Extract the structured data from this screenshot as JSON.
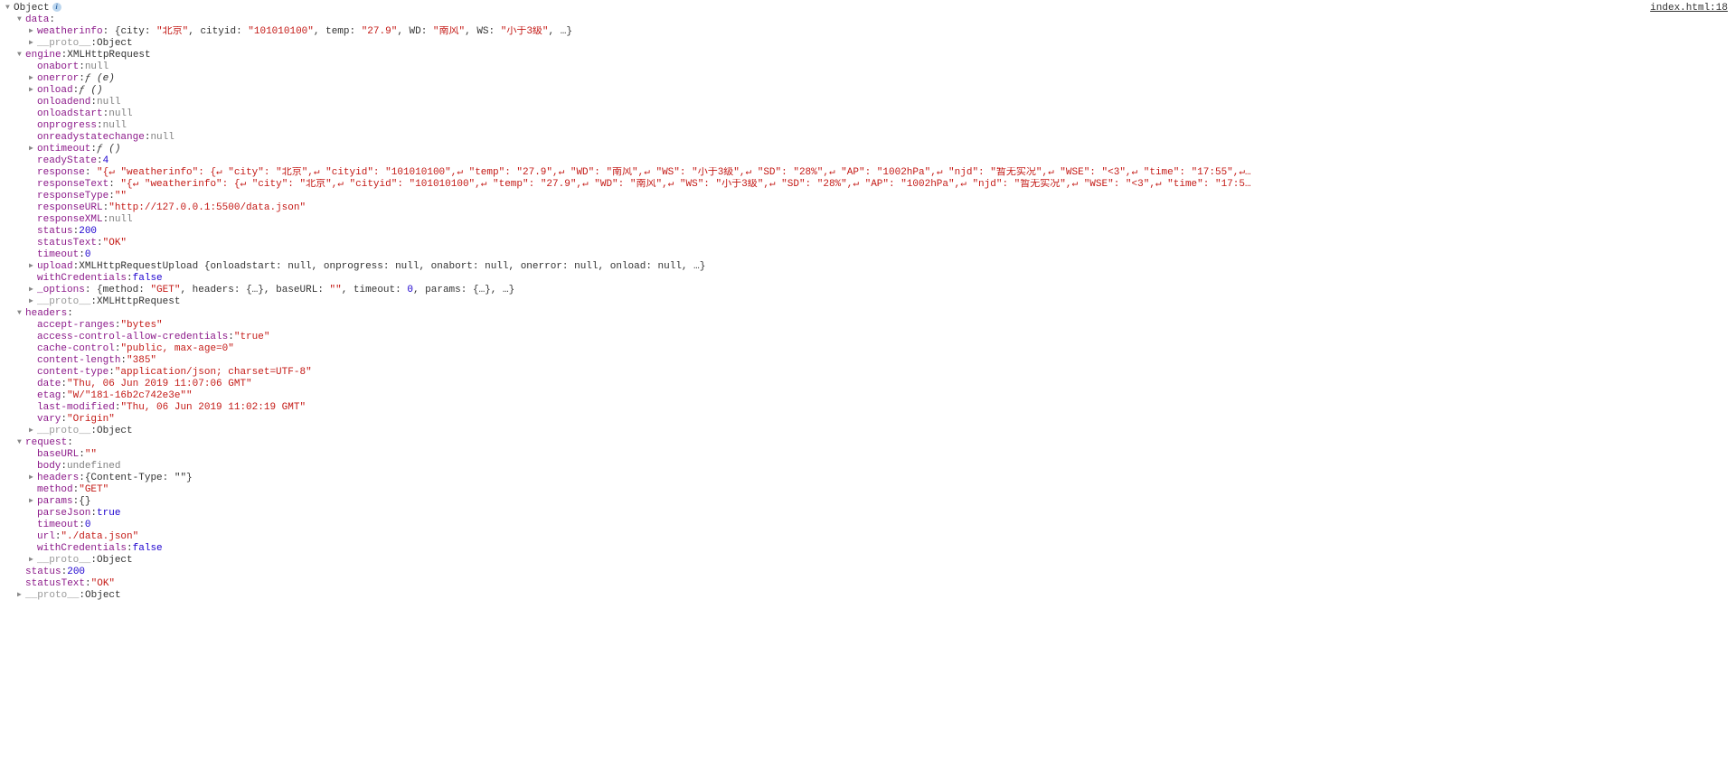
{
  "source_link": "index.html:18",
  "root_label": "Object",
  "data_key": "data",
  "weatherinfo_key": "weatherinfo",
  "weatherinfo_preview_parts": {
    "open": "{",
    "city_k": "city",
    "city_v": "\"北京\"",
    "cityid_k": "cityid",
    "cityid_v": "\"101010100\"",
    "temp_k": "temp",
    "temp_v": "\"27.9\"",
    "wd_k": "WD",
    "wd_v": "\"南风\"",
    "ws_k": "WS",
    "ws_v": "\"小于3级\"",
    "ellipsis": ", …}",
    "close": ""
  },
  "proto_key": "__proto__",
  "proto_obj": "Object",
  "proto_xhr": "XMLHttpRequest",
  "engine_key": "engine",
  "engine_type": "XMLHttpRequest",
  "engine_props": {
    "onabort": "null",
    "onerror": "ƒ (e)",
    "onload": "ƒ ()",
    "onloadend": "null",
    "onloadstart": "null",
    "onprogress": "null",
    "onreadystatechange": "null",
    "ontimeout": "ƒ ()",
    "readyState": "4",
    "responseType": "\"\"",
    "responseURL": "\"http://127.0.0.1:5500/data.json\"",
    "responseXML": "null",
    "status": "200",
    "statusText": "\"OK\"",
    "timeout": "0",
    "withCredentials": "false"
  },
  "response_key": "response",
  "responseText_key": "responseText",
  "resp_line": {
    "open": "\"{↵    \"weatherinfo\": {↵        \"city\": ",
    "v_city": "\"北京\"",
    "c1": ",↵        \"cityid\": ",
    "v_cityid": "\"101010100\"",
    "c2": ",↵        \"temp\": ",
    "v_temp": "\"27.9\"",
    "c3": ",↵        \"WD\": ",
    "v_wd": "\"南风\"",
    "c4": ",↵        \"WS\": ",
    "v_ws": "\"小于3级\"",
    "c5": ",↵        \"SD\": ",
    "v_sd": "\"28%\"",
    "c6": ",↵        \"AP\": ",
    "v_ap": "\"1002hPa\"",
    "c7": ",↵        \"njd\": ",
    "v_njd": "\"暂无实况\"",
    "c8": ",↵        \"WSE\": ",
    "v_wse": "\"<3\"",
    "c9": ",↵        \"time\": ",
    "v_time": "\"17:55\"",
    "c10": ",↵…"
  },
  "resp_text_line": {
    "open": "\"{↵    \"weatherinfo\": {↵        \"city\": ",
    "v_city": "\"北京\"",
    "c1": ",↵        \"cityid\": ",
    "v_cityid": "\"101010100\"",
    "c2": ",↵        \"temp\": ",
    "v_temp": "\"27.9\"",
    "c3": ",↵        \"WD\": ",
    "v_wd": "\"南风\"",
    "c4": ",↵        \"WS\": ",
    "v_ws": "\"小于3级\"",
    "c5": ",↵        \"SD\": ",
    "v_sd": "\"28%\"",
    "c6": ",↵        \"AP\": ",
    "v_ap": "\"1002hPa\"",
    "c7": ",↵        \"njd\": ",
    "v_njd": "\"暂无实况\"",
    "c8": ",↵        \"WSE\": ",
    "v_wse": "\"<3\"",
    "c9": ",↵        \"time\": ",
    "v_time": "\"17:5…"
  },
  "upload_key": "upload",
  "upload_preview": "XMLHttpRequestUpload {onloadstart: null, onprogress: null, onabort: null, onerror: null, onload: null, …}",
  "options_key": "_options",
  "options_preview_parts": {
    "open": "{",
    "method_k": "method",
    "method_v": "\"GET\"",
    "headers_k": "headers",
    "headers_v": "{…}",
    "baseurl_k": "baseURL",
    "baseurl_v": "\"\"",
    "timeout_k": "timeout",
    "timeout_v": "0",
    "params_k": "params",
    "params_v": "{…}",
    "close": ", …}"
  },
  "headers_key": "headers",
  "headers": {
    "accept-ranges": "\"bytes\"",
    "access-control-allow-credentials": "\"true\"",
    "cache-control": "\"public, max-age=0\"",
    "content-length": "\"385\"",
    "content-type": "\"application/json; charset=UTF-8\"",
    "date": "\"Thu, 06 Jun 2019 11:07:06 GMT\"",
    "etag": "\"W/\"181-16b2c742e3e\"\"",
    "last-modified": "\"Thu, 06 Jun 2019 11:02:19 GMT\"",
    "vary": "\"Origin\""
  },
  "request_key": "request",
  "request": {
    "baseURL": "\"\"",
    "body_k": "body",
    "body_v": "undefined",
    "headers_preview": "{Content-Type: \"\"}",
    "method": "\"GET\"",
    "params_preview": "{}",
    "parseJson": "true",
    "timeout": "0",
    "url": "\"./data.json\"",
    "withCredentials": "false"
  },
  "status_key": "status",
  "status_val": "200",
  "statusText_key": "statusText",
  "statusText_val": "\"OK\"",
  "literals": {
    "colon": ": ",
    "comma_sp": ", "
  },
  "keys": {
    "onabort": "onabort",
    "onerror": "onerror",
    "onload": "onload",
    "onloadend": "onloadend",
    "onloadstart": "onloadstart",
    "onprogress": "onprogress",
    "onreadystatechange": "onreadystatechange",
    "ontimeout": "ontimeout",
    "readyState": "readyState",
    "responseType": "responseType",
    "responseURL": "responseURL",
    "responseXML": "responseXML",
    "status": "status",
    "statusText": "statusText",
    "timeout": "timeout",
    "upload": "upload",
    "withCredentials": "withCredentials",
    "accept_ranges": "accept-ranges",
    "acac": "access-control-allow-credentials",
    "cache_control": "cache-control",
    "content_length": "content-length",
    "content_type": "content-type",
    "date": "date",
    "etag": "etag",
    "last_modified": "last-modified",
    "vary": "vary",
    "baseURL": "baseURL",
    "body": "body",
    "headers": "headers",
    "method": "method",
    "params": "params",
    "parseJson": "parseJson",
    "url": "url"
  }
}
